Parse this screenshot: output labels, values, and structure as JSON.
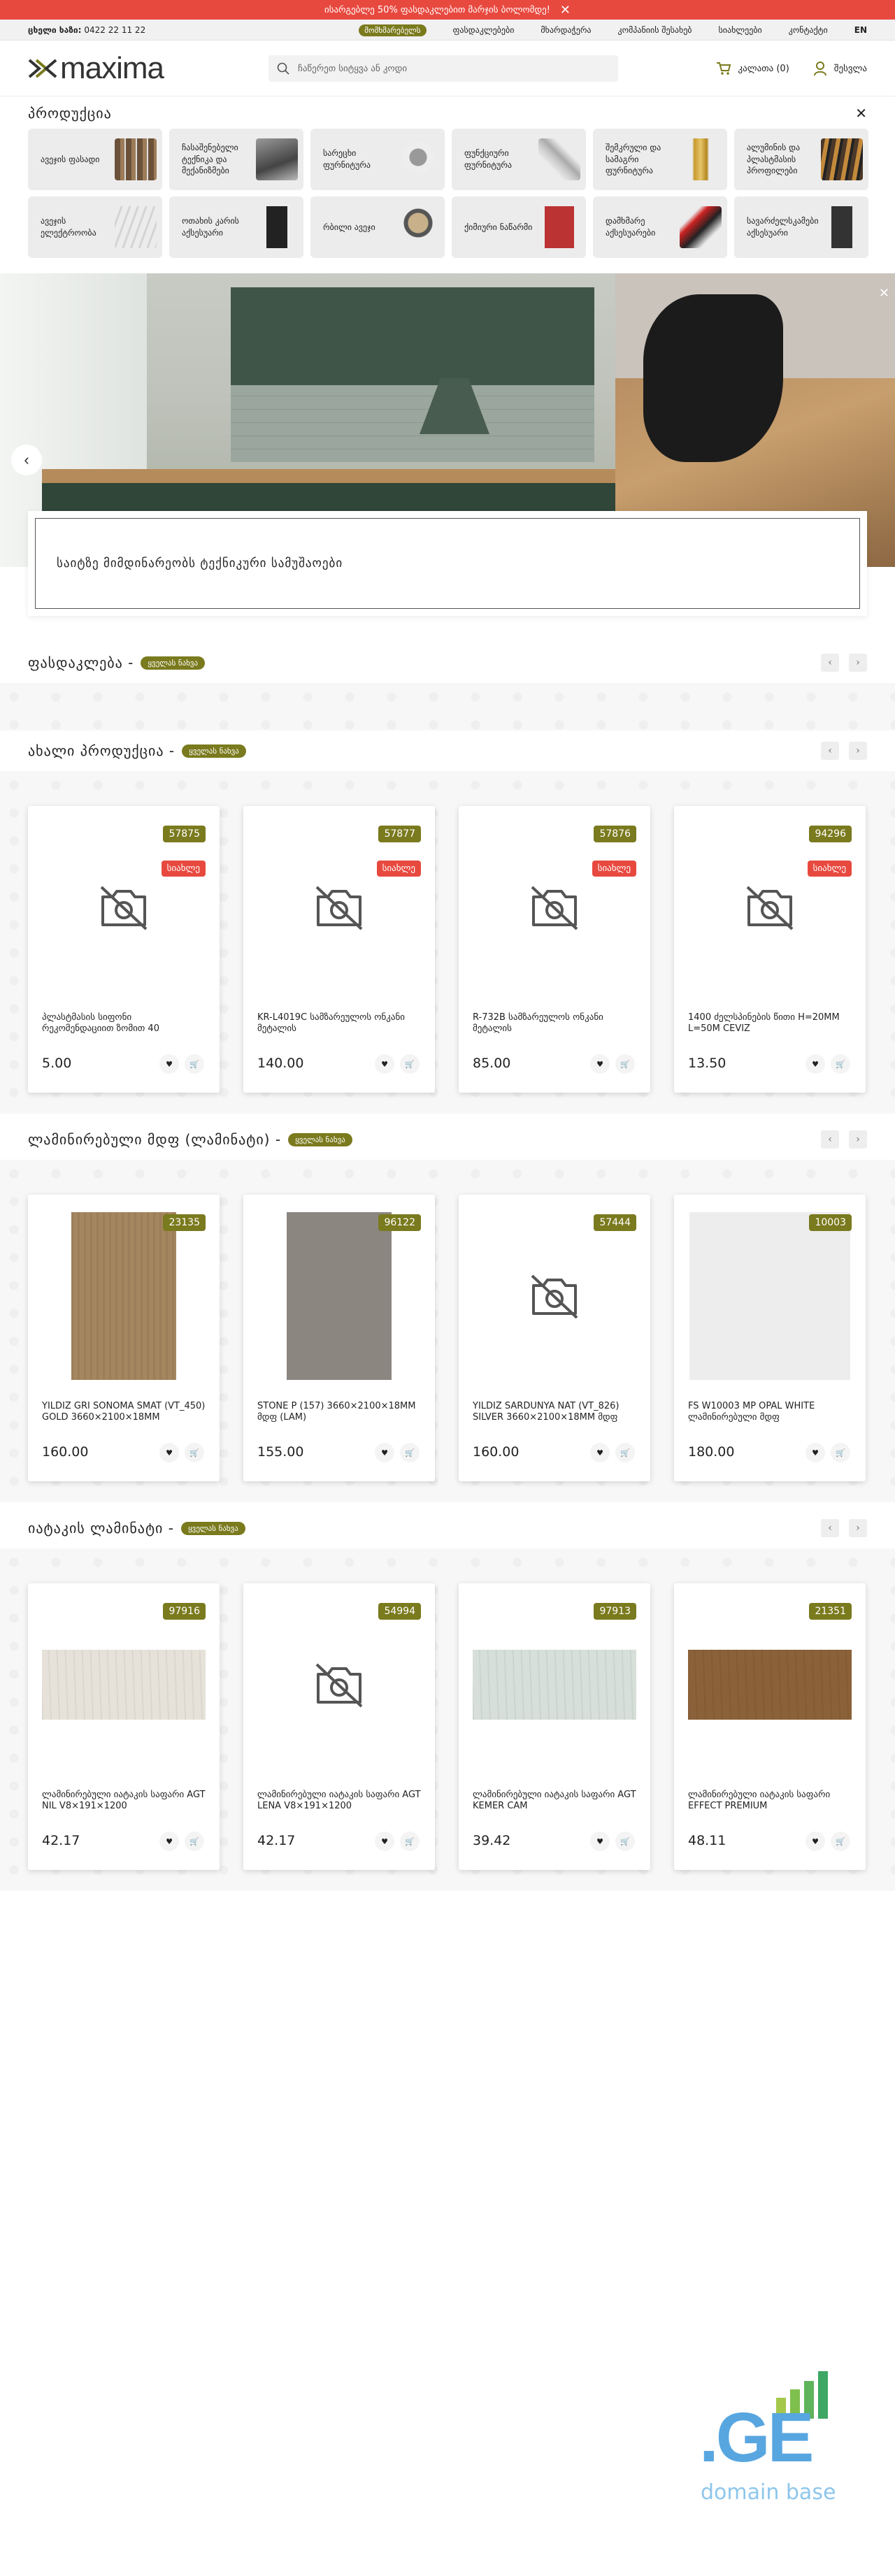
{
  "promo": {
    "text": "ისარგებლე 50% ფასდაკლებით მარჯის ბოლომდე!"
  },
  "topbar": {
    "phone_label": "ცხელი ხაზი:",
    "phone": "0422 22 11 22",
    "nav": [
      "მომხმარებელს",
      "ფასდაკლებები",
      "მხარდაჭერა",
      "კომპანიის შესახებ",
      "სიახლეები",
      "კონტაქტი"
    ],
    "lang": "EN"
  },
  "header": {
    "logo_text": "maxima",
    "search_placeholder": "ჩაწერეთ სიტყვა ან კოდი",
    "cart": "კალათა (0)",
    "login": "შესვლა"
  },
  "menu": {
    "title": "პროდუქცია",
    "categories": [
      "ავეჯის ფასადი",
      "ჩასაშენებელი ტექნიკა და მექანიზმები",
      "სარეცხი ფურნიტურა",
      "ფუნქციური ფურნიტურა",
      "შემკრული და სამაგრი ფურნიტურა",
      "ალუმინის და პლასტმასის პროფილები",
      "ავეჯის ელექტროობა",
      "ოთახის კარის აქსესუარი",
      "რბილი ავეჯი",
      "ქიმიური ნაწარმი",
      "დამხმარე აქსესუარები",
      "სავარძელსკამები აქსესუარი"
    ]
  },
  "notice": {
    "text": "საიტზე მიმდინარეობს ტექნიკური სამუშაოები"
  },
  "sections": {
    "discounts": {
      "title": "ფასდაკლება -",
      "all": "ყველას ნახვა"
    },
    "new_products": {
      "title": "ახალი პროდუქცია -",
      "all": "ყველას ნახვა",
      "items": [
        {
          "code": "57875",
          "badge": "სიახლე",
          "name": "პლასტმასის სიფონი რეკომენდაციით ზომით 40",
          "price": "5.00"
        },
        {
          "code": "57877",
          "badge": "სიახლე",
          "name": "KR-L4019C სამზარეულოს ონკანი მეტალის",
          "price": "140.00"
        },
        {
          "code": "57876",
          "badge": "სიახლე",
          "name": "R-732B სამზარეულოს ონკანი მეტალის",
          "price": "85.00"
        },
        {
          "code": "94296",
          "badge": "სიახლე",
          "name": "1400 ძელსპინების წითი H=20MM L=50M CEVIZ",
          "price": "13.50"
        }
      ]
    },
    "laminated": {
      "title": "ლამინირებული მდფ (ლამინატი) -",
      "all": "ყველას ნახვა",
      "items": [
        {
          "code": "23135",
          "name": "YILDIZ GRI SONOMA SMAT (VT_450) GOLD 3660×2100×18MM",
          "price": "160.00",
          "swatch": "#a5865f"
        },
        {
          "code": "96122",
          "name": "STONE P (157) 3660×2100×18MM მდფ (LAM)",
          "price": "155.00",
          "swatch": "#8c8681"
        },
        {
          "code": "57444",
          "name": "YILDIZ SARDUNYA NAT (VT_826) SILVER 3660×2100×18MM მდფ",
          "price": "160.00",
          "swatch": ""
        },
        {
          "code": "10003",
          "name": "FS W10003 MP OPAL WHITE ლამინირებული მდფ",
          "price": "180.00",
          "swatch": "#ededed"
        }
      ]
    },
    "floor": {
      "title": "იატაკის ლამინატი -",
      "all": "ყველას ნახვა",
      "items": [
        {
          "code": "97916",
          "name": "ლამინირებული იატაკის საფარი AGT NIL V8×191×1200",
          "price": "42.17",
          "swatch": "#e7e2d9"
        },
        {
          "code": "54994",
          "name": "ლამინირებული იატაკის საფარი AGT LENA V8×191×1200",
          "price": "42.17",
          "swatch": ""
        },
        {
          "code": "97913",
          "name": "ლამინირებული იატაკის საფარი AGT KEMER CAM",
          "price": "39.42",
          "swatch": "#d6dfd9"
        },
        {
          "code": "21351",
          "name": "ლამინირებული იატაკის საფარი EFFECT PREMIUM",
          "price": "48.11",
          "swatch": "#8a6138"
        }
      ]
    }
  },
  "footer_logo": {
    "main": ".GE",
    "sub": "domain base"
  }
}
